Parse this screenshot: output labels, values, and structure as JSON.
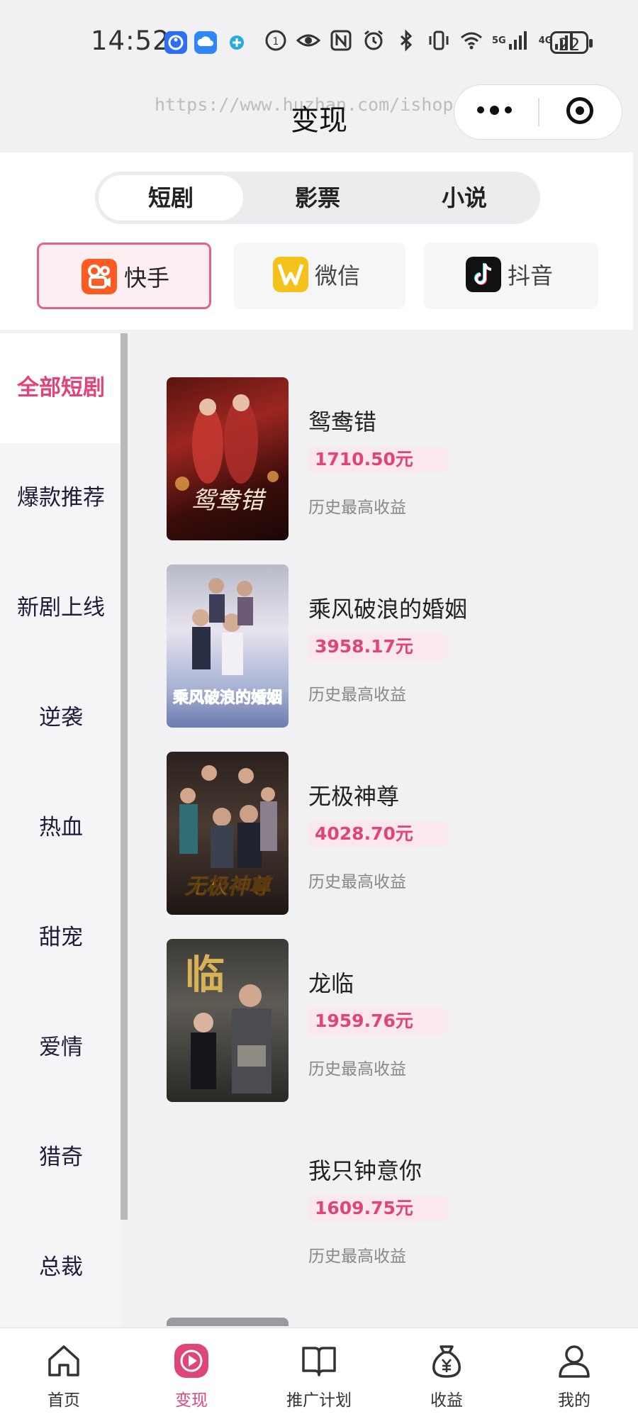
{
  "status_bar": {
    "time": "14:52",
    "signal_5g": "5G",
    "signal_4g": "4G",
    "battery": "22",
    "icons": [
      "accessibility-icon",
      "cloud-icon",
      "browser-icon",
      "data-saver-icon",
      "eye-icon",
      "nfc-icon",
      "alarm-icon",
      "bluetooth-icon",
      "vibrate-icon",
      "wifi-icon",
      "signal-icon",
      "battery-icon"
    ]
  },
  "title_bar": {
    "title": "变现",
    "watermark": "https://www.huzhan.com/ishop46378"
  },
  "segments": {
    "tabs": [
      {
        "label": "短剧",
        "active": true
      },
      {
        "label": "影票",
        "active": false
      },
      {
        "label": "小说",
        "active": false
      }
    ]
  },
  "platforms": [
    {
      "label": "快手",
      "icon": "kuaishou-logo-icon",
      "color": "#ff5a1f",
      "active": true
    },
    {
      "label": "微信",
      "icon": "wechat-logo-icon",
      "color": "#f5c21b",
      "active": false
    },
    {
      "label": "抖音",
      "icon": "douyin-logo-icon",
      "color": "#111111",
      "active": false
    }
  ],
  "sidebar": {
    "items": [
      {
        "label": "全部短剧",
        "active": true
      },
      {
        "label": "爆款推荐",
        "active": false
      },
      {
        "label": "新剧上线",
        "active": false
      },
      {
        "label": "逆袭",
        "active": false
      },
      {
        "label": "热血",
        "active": false
      },
      {
        "label": "甜宠",
        "active": false
      },
      {
        "label": "爱情",
        "active": false
      },
      {
        "label": "猎奇",
        "active": false
      },
      {
        "label": "总裁",
        "active": false
      }
    ]
  },
  "dramas": [
    {
      "title": "鸳鸯错",
      "price": "1710.50元",
      "note": "历史最高收益",
      "poster_text": "鸳鸯错"
    },
    {
      "title": "乘风破浪的婚姻",
      "price": "3958.17元",
      "note": "历史最高收益",
      "poster_text": "乘风破浪的婚姻"
    },
    {
      "title": "无极神尊",
      "price": "4028.70元",
      "note": "历史最高收益",
      "poster_text": "无极神尊"
    },
    {
      "title": "龙临",
      "price": "1959.76元",
      "note": "历史最高收益",
      "poster_text": "临"
    },
    {
      "title": "我只钟意你",
      "price": "1609.75元",
      "note": "历史最高收益",
      "poster_text": ""
    }
  ],
  "bottom_nav": [
    {
      "label": "首页",
      "icon": "home-icon",
      "active": false
    },
    {
      "label": "变现",
      "icon": "play-icon",
      "active": true
    },
    {
      "label": "推广计划",
      "icon": "book-icon",
      "active": false
    },
    {
      "label": "收益",
      "icon": "money-bag-icon",
      "active": false
    },
    {
      "label": "我的",
      "icon": "user-icon",
      "active": false
    }
  ],
  "colors": {
    "accent": "#e0457a",
    "price_bg": "#fbe8ee",
    "active_platform_bg": "#fdeef1"
  }
}
